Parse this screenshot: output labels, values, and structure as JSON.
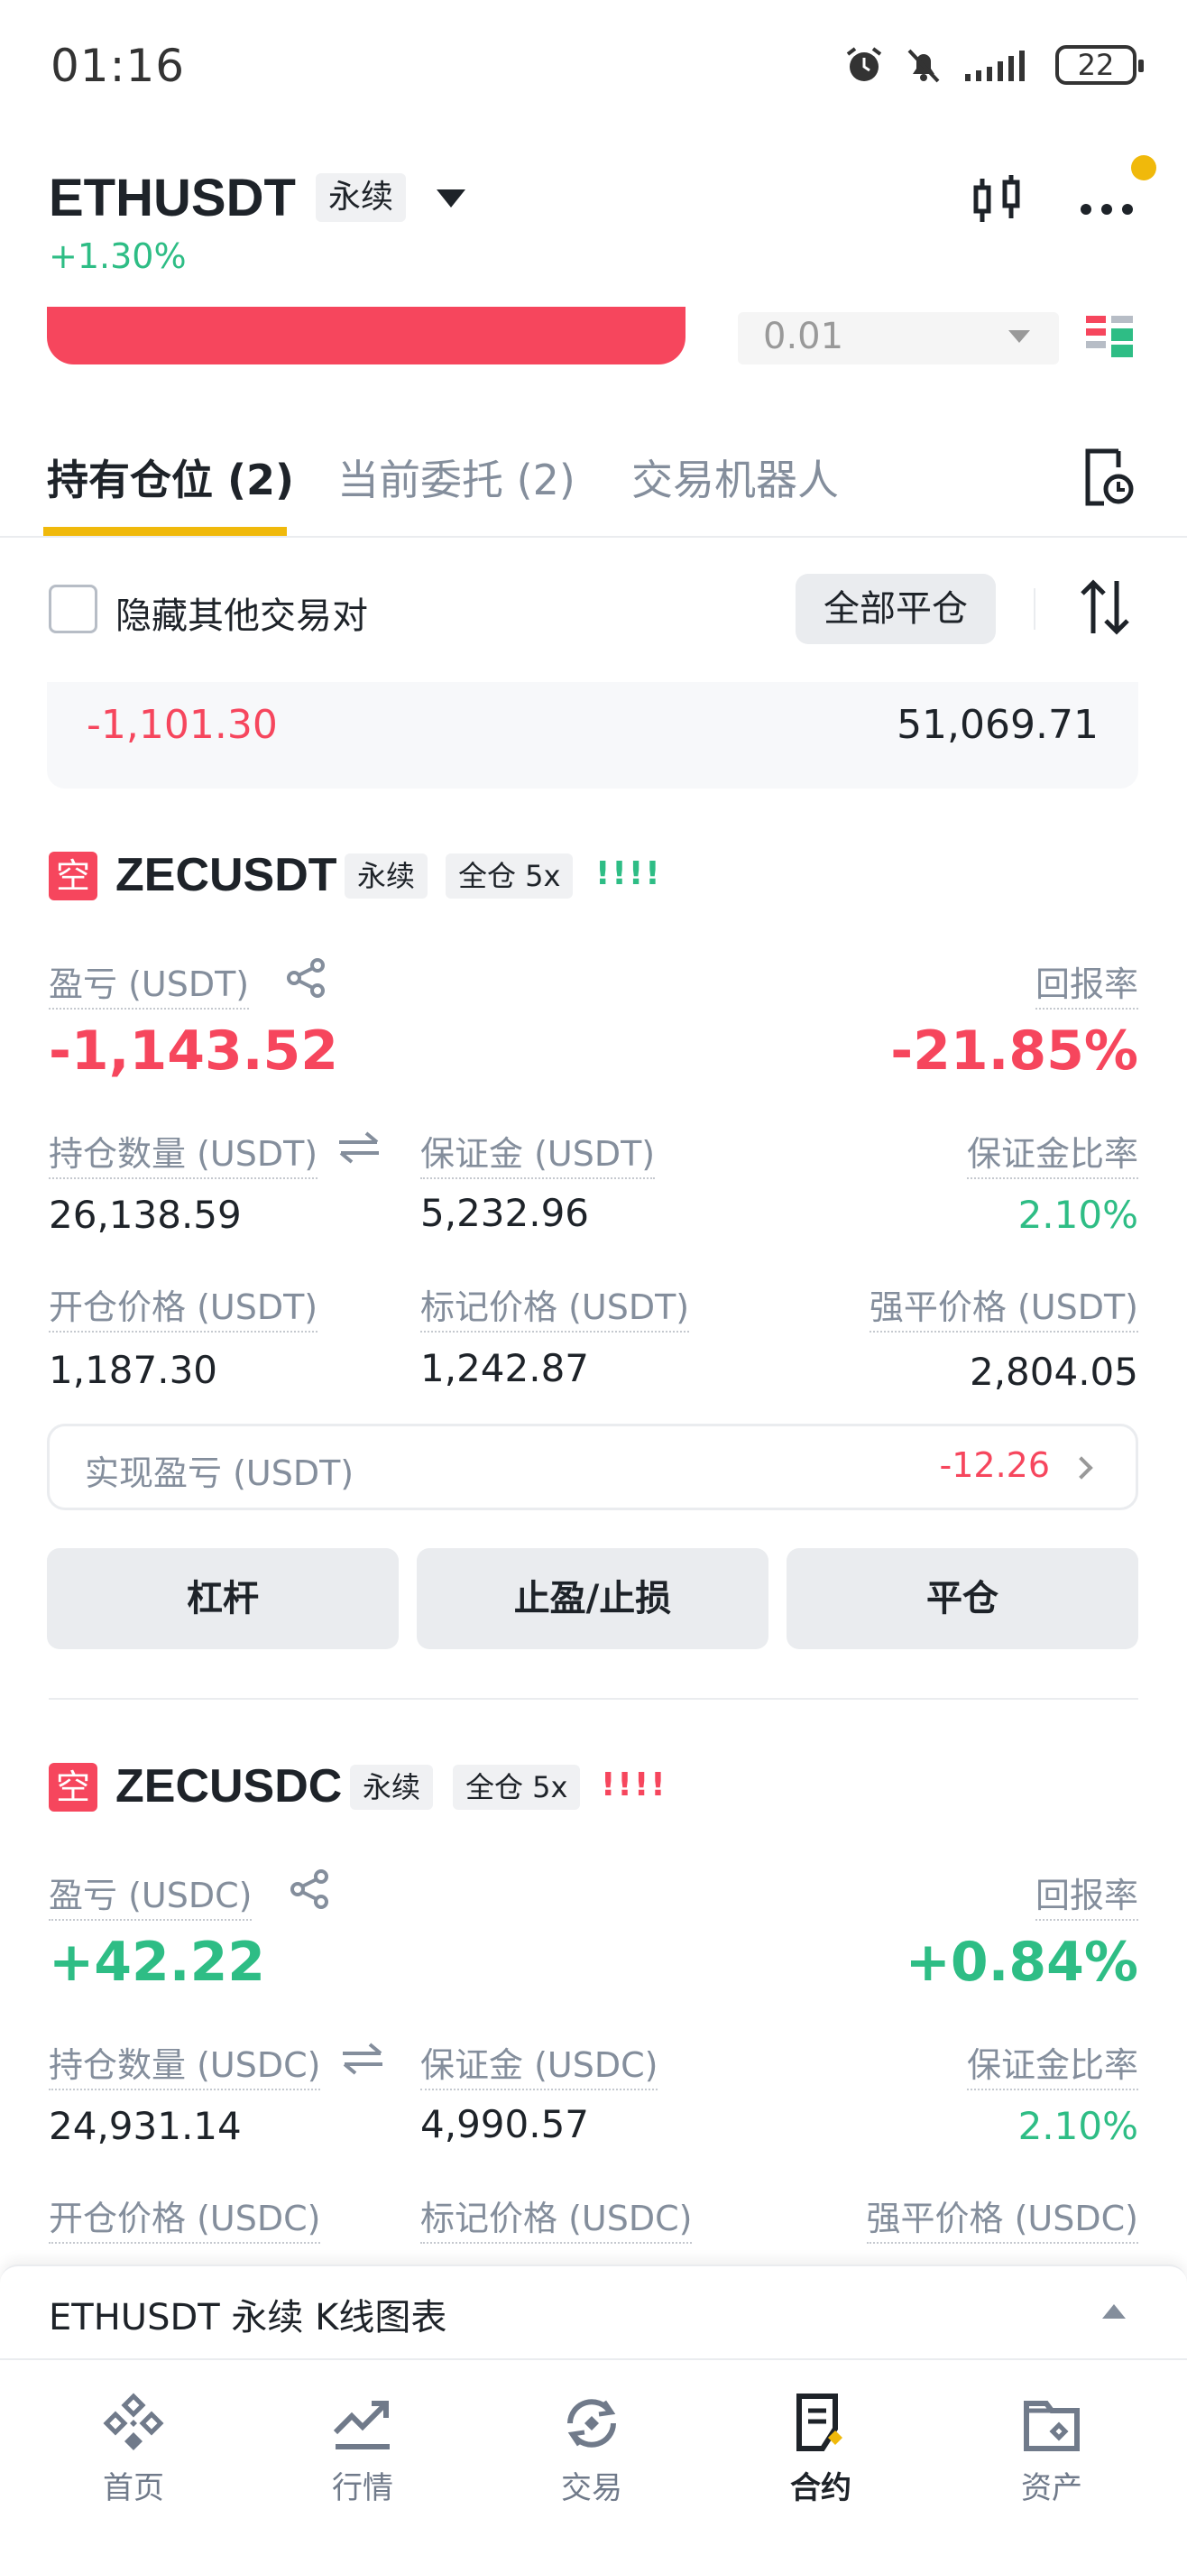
{
  "status_bar": {
    "time": "01:16",
    "battery": "22"
  },
  "header": {
    "symbol": "ETHUSDT",
    "tag": "永续",
    "change": "+1.30%"
  },
  "order": {
    "quantity": "0.01"
  },
  "tabs": [
    {
      "label": "持有仓位 (2)"
    },
    {
      "label": "当前委托 (2)"
    },
    {
      "label": "交易机器人"
    }
  ],
  "filter": {
    "hide_label": "隐藏其他交易对",
    "close_all": "全部平仓"
  },
  "summary": {
    "pnl": "-1,101.30",
    "total": "51,069.71"
  },
  "positions": [
    {
      "side": "空",
      "symbol": "ZECUSDT",
      "tag_perp": "永续",
      "tag_margin": "全仓 5x",
      "risk": "!!!!",
      "pnl_label": "盈亏 (USDT)",
      "pnl": "-1,143.52",
      "roe_label": "回报率",
      "roe": "-21.85%",
      "size_label": "持仓数量 (USDT)",
      "size": "26,138.59",
      "margin_label": "保证金 (USDT)",
      "margin": "5,232.96",
      "margin_ratio_label": "保证金比率",
      "margin_ratio": "2.10%",
      "entry_label": "开仓价格 (USDT)",
      "entry": "1,187.30",
      "mark_label": "标记价格 (USDT)",
      "mark": "1,242.87",
      "liq_label": "强平价格 (USDT)",
      "liq": "2,804.05",
      "realized_label": "实现盈亏 (USDT)",
      "realized": "-12.26",
      "btn_leverage": "杠杆",
      "btn_tpsl": "止盈/止损",
      "btn_close": "平仓"
    },
    {
      "side": "空",
      "symbol": "ZECUSDC",
      "tag_perp": "永续",
      "tag_margin": "全仓 5x",
      "risk": "!!!!",
      "pnl_label": "盈亏 (USDC)",
      "pnl": "+42.22",
      "roe_label": "回报率",
      "roe": "+0.84%",
      "size_label": "持仓数量 (USDC)",
      "size": "24,931.14",
      "margin_label": "保证金 (USDC)",
      "margin": "4,990.57",
      "margin_ratio_label": "保证金比率",
      "margin_ratio": "2.10%",
      "entry_label": "开仓价格 (USDC)",
      "mark_label": "标记价格 (USDC)",
      "liq_label": "强平价格 (USDC)"
    }
  ],
  "kline": {
    "label": "ETHUSDT 永续 K线图表"
  },
  "nav": [
    {
      "label": "首页",
      "icon": "home-icon"
    },
    {
      "label": "行情",
      "icon": "markets-icon"
    },
    {
      "label": "交易",
      "icon": "trade-icon"
    },
    {
      "label": "合约",
      "icon": "futures-icon"
    },
    {
      "label": "资产",
      "icon": "wallet-icon"
    }
  ],
  "colors": {
    "accent": "#f0b90b",
    "red": "#f6465d",
    "green": "#2ebd85"
  }
}
